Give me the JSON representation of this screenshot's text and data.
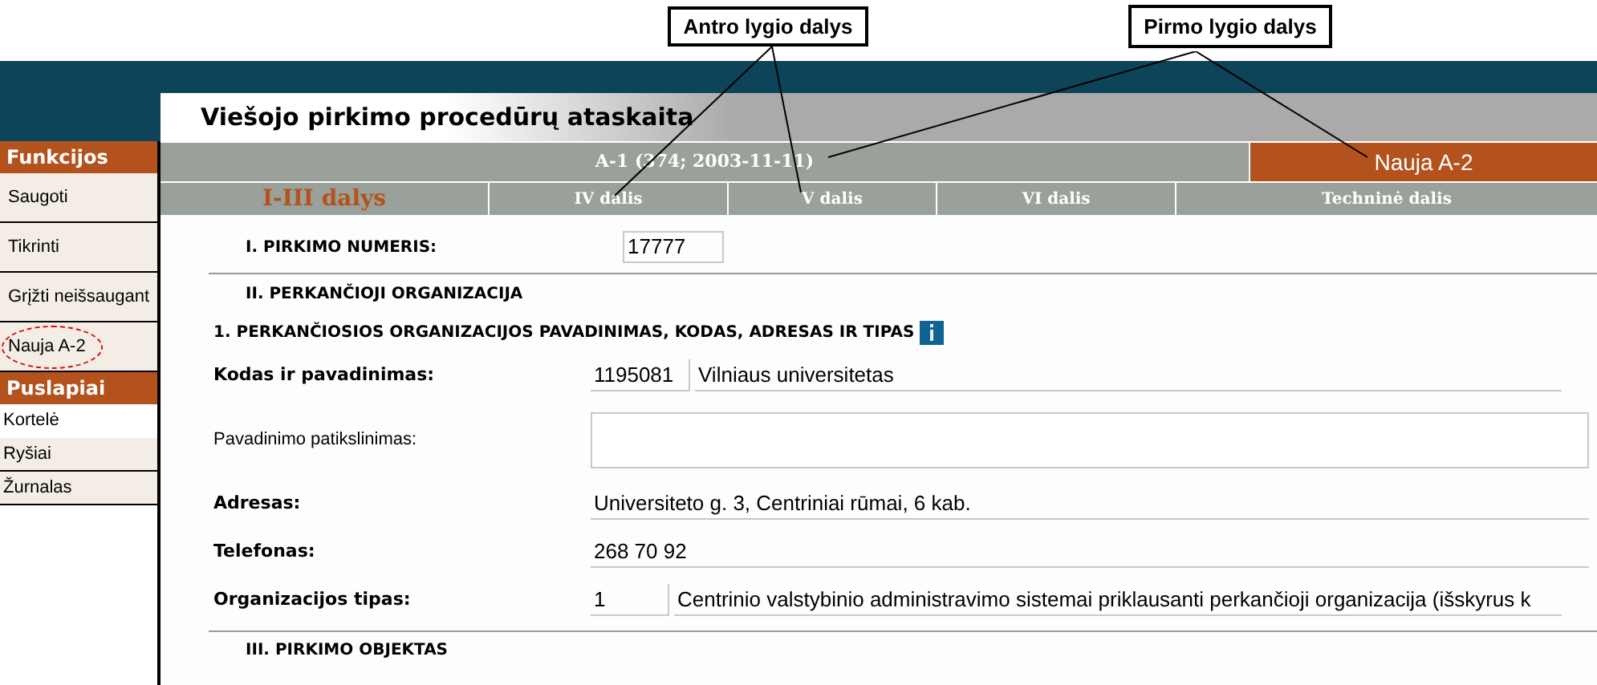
{
  "callouts": [
    {
      "label": "Antro lygio dalys"
    },
    {
      "label": "Pirmo lygio dalys"
    }
  ],
  "title": "Viešojo pirkimo procedūrų ataskaita",
  "sidebar": {
    "sections": [
      {
        "title": "Funkcijos",
        "kind": "actions",
        "items": [
          {
            "label": "Saugoti",
            "circled": false,
            "selected": false
          },
          {
            "label": "Tikrinti",
            "circled": false,
            "selected": false
          },
          {
            "label": "Grįžti neišsaugant",
            "circled": false,
            "selected": false
          },
          {
            "label": "Nauja A-2",
            "circled": true,
            "selected": false
          }
        ]
      },
      {
        "title": "Puslapiai",
        "kind": "pages",
        "items": [
          {
            "label": "Kortelė",
            "circled": false,
            "selected": true
          },
          {
            "label": "Ryšiai",
            "circled": false,
            "selected": false
          },
          {
            "label": "Žurnalas",
            "circled": false,
            "selected": false
          }
        ]
      }
    ]
  },
  "level1_tabs": [
    {
      "label": "A-1 (374; 2003-11-11)",
      "selected": false
    },
    {
      "label": "Nauja A-2",
      "selected": true
    }
  ],
  "level2_tabs": [
    {
      "label": "I-III dalys",
      "selected": true
    },
    {
      "label": "IV dalis",
      "selected": false
    },
    {
      "label": "V dalis",
      "selected": false
    },
    {
      "label": "VI dalis",
      "selected": false
    },
    {
      "label": "Techninė dalis",
      "selected": false
    }
  ],
  "form": {
    "number_label": "I. PIRKIMO NUMERIS:",
    "number_value": "17777",
    "section_2": "II. PERKANČIOJI ORGANIZACIJA",
    "subsection": "1. PERKANČIOSIOS ORGANIZACIJOS PAVADINIMAS, KODAS, ADRESAS IR TIPAS",
    "rows": [
      {
        "label": "Kodas ir pavadinimas:",
        "emphasized": true,
        "kind": "code_name",
        "values": [
          "1195081",
          "Vilniaus universitetas"
        ]
      },
      {
        "label": "Pavadinimo patikslinimas:",
        "emphasized": false,
        "kind": "textarea",
        "values": []
      },
      {
        "label": "Adresas:",
        "emphasized": true,
        "kind": "text",
        "values": [
          "Universiteto g. 3, Centriniai rūmai, 6 kab."
        ]
      },
      {
        "label": "Telefonas:",
        "emphasized": true,
        "kind": "text",
        "values": [
          "268 70 92"
        ]
      },
      {
        "label": "Organizacijos tipas:",
        "emphasized": true,
        "kind": "code_name",
        "values": [
          "1",
          "Centrinio valstybinio administravimo sistemai priklausanti perkančioji organizacija (išskyrus k"
        ]
      }
    ],
    "section_3": "III. PIRKIMO OBJEKTAS"
  }
}
